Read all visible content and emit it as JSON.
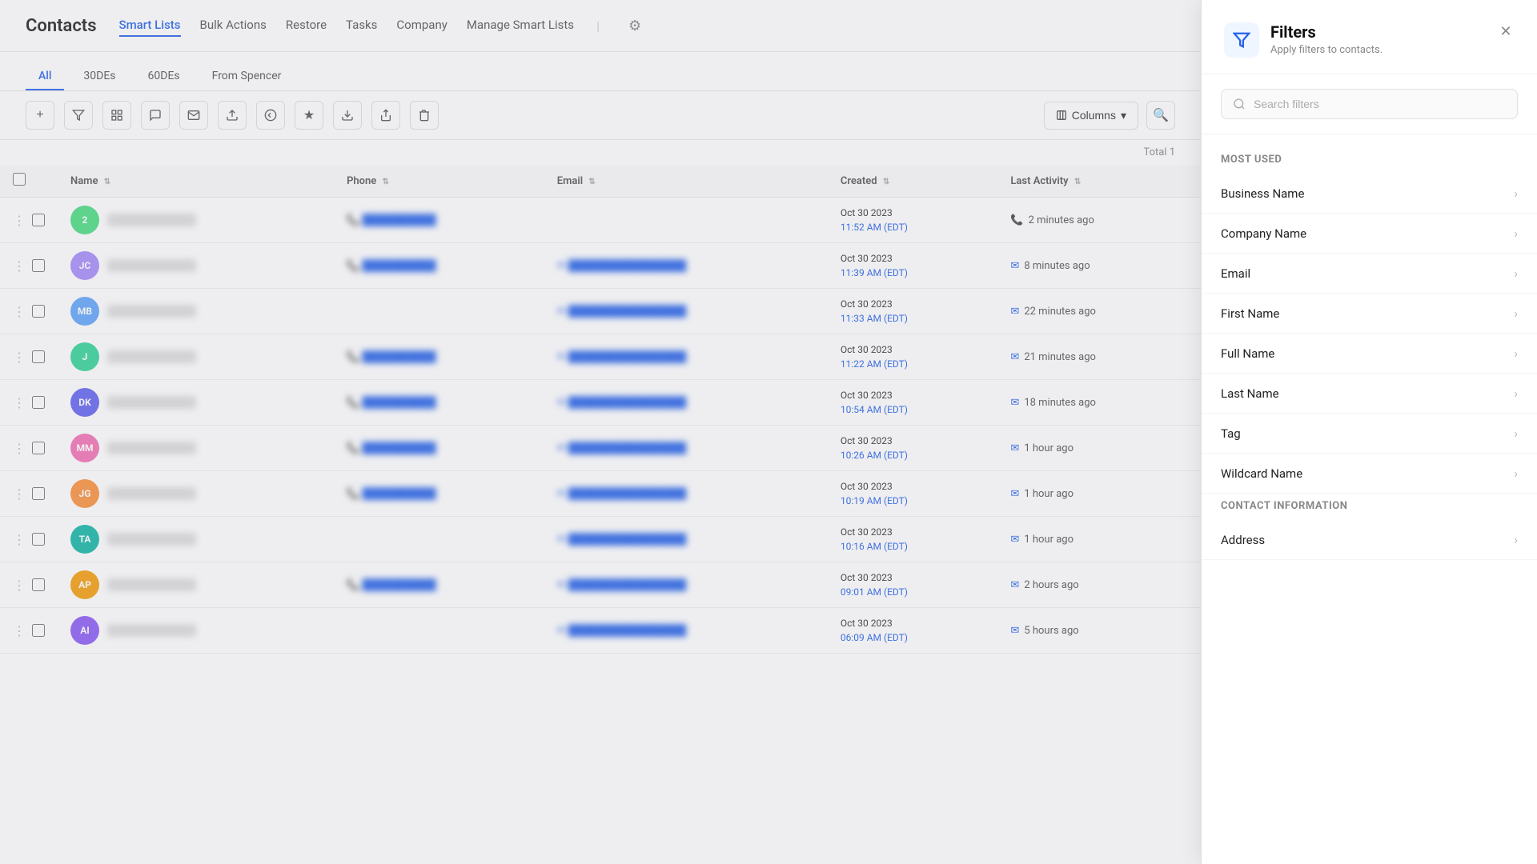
{
  "app": {
    "title": "Contacts"
  },
  "topNav": {
    "tabs": [
      {
        "id": "smart-lists",
        "label": "Smart Lists",
        "active": true
      },
      {
        "id": "bulk-actions",
        "label": "Bulk Actions",
        "active": false
      },
      {
        "id": "restore",
        "label": "Restore",
        "active": false
      },
      {
        "id": "tasks",
        "label": "Tasks",
        "active": false
      },
      {
        "id": "company",
        "label": "Company",
        "active": false
      },
      {
        "id": "manage-smart-lists",
        "label": "Manage Smart Lists",
        "active": false
      }
    ]
  },
  "subTabs": [
    {
      "id": "all",
      "label": "All",
      "active": true
    },
    {
      "id": "30des",
      "label": "30DEs",
      "active": false
    },
    {
      "id": "60des",
      "label": "60DEs",
      "active": false
    },
    {
      "id": "from-spencer",
      "label": "From Spencer",
      "active": false
    }
  ],
  "table": {
    "totalLabel": "Total 1",
    "columns": [
      "Name",
      "Phone",
      "Email",
      "Created",
      "Last Activity"
    ],
    "rows": [
      {
        "id": 1,
        "initials": "2",
        "avatarColor": "#4ade80",
        "name": "blurred",
        "phone": "blurred",
        "email": "",
        "created_date": "Oct 30 2023",
        "created_time": "11:52 AM (EDT)",
        "activity": "2 minutes ago",
        "activity_icon": "phone"
      },
      {
        "id": 2,
        "initials": "JC",
        "avatarColor": "#a78bfa",
        "name": "blurred",
        "phone": "blurred",
        "email": "blurred",
        "created_date": "Oct 30 2023",
        "created_time": "11:39 AM (EDT)",
        "activity": "8 minutes ago",
        "activity_icon": "email"
      },
      {
        "id": 3,
        "initials": "MB",
        "avatarColor": "#60a5fa",
        "name": "blurred",
        "phone": "",
        "email": "blurred",
        "created_date": "Oct 30 2023",
        "created_time": "11:33 AM (EDT)",
        "activity": "22 minutes ago",
        "activity_icon": "email"
      },
      {
        "id": 4,
        "initials": "J",
        "avatarColor": "#34d399",
        "name": "blurred",
        "phone": "blurred",
        "email": "blurred",
        "created_date": "Oct 30 2023",
        "created_time": "11:22 AM (EDT)",
        "activity": "21 minutes ago",
        "activity_icon": "email"
      },
      {
        "id": 5,
        "initials": "DK",
        "avatarColor": "#6366f1",
        "name": "blurred",
        "phone": "blurred",
        "email": "blurred",
        "created_date": "Oct 30 2023",
        "created_time": "10:54 AM (EDT)",
        "activity": "18 minutes ago",
        "activity_icon": "email"
      },
      {
        "id": 6,
        "initials": "MM",
        "avatarColor": "#f472b6",
        "name": "blurred",
        "phone": "blurred",
        "email": "blurred",
        "created_date": "Oct 30 2023",
        "created_time": "10:26 AM (EDT)",
        "activity": "1 hour ago",
        "activity_icon": "email"
      },
      {
        "id": 7,
        "initials": "JG",
        "avatarColor": "#fb923c",
        "name": "blurred",
        "phone": "blurred",
        "email": "blurred",
        "created_date": "Oct 30 2023",
        "created_time": "10:19 AM (EDT)",
        "activity": "1 hour ago",
        "activity_icon": "email"
      },
      {
        "id": 8,
        "initials": "TA",
        "avatarColor": "#14b8a6",
        "name": "blurred",
        "phone": "",
        "email": "blurred",
        "created_date": "Oct 30 2023",
        "created_time": "10:16 AM (EDT)",
        "activity": "1 hour ago",
        "activity_icon": "email"
      },
      {
        "id": 9,
        "initials": "AP",
        "avatarColor": "#f59e0b",
        "name": "blurred",
        "phone": "blurred",
        "email": "blurred",
        "created_date": "Oct 30 2023",
        "created_time": "09:01 AM (EDT)",
        "activity": "2 hours ago",
        "activity_icon": "email"
      },
      {
        "id": 10,
        "initials": "AI",
        "avatarColor": "#8b5cf6",
        "name": "blurred",
        "phone": "",
        "email": "blurred",
        "created_date": "Oct 30 2023",
        "created_time": "06:09 AM (EDT)",
        "activity": "5 hours ago",
        "activity_icon": "email"
      }
    ]
  },
  "filters": {
    "title": "Filters",
    "subtitle": "Apply filters to contacts.",
    "searchPlaceholder": "Search filters",
    "mostUsedLabel": "Most Used",
    "contactInfoLabel": "Contact Information",
    "items": [
      {
        "id": "business-name",
        "label": "Business Name"
      },
      {
        "id": "company-name",
        "label": "Company Name"
      },
      {
        "id": "email",
        "label": "Email"
      },
      {
        "id": "first-name",
        "label": "First Name"
      },
      {
        "id": "full-name",
        "label": "Full Name"
      },
      {
        "id": "last-name",
        "label": "Last Name"
      },
      {
        "id": "tag",
        "label": "Tag"
      },
      {
        "id": "wildcard-name",
        "label": "Wildcard Name"
      }
    ],
    "contactInfoItems": [
      {
        "id": "address",
        "label": "Address"
      }
    ]
  },
  "toolbar": {
    "columnsLabel": "Columns"
  }
}
